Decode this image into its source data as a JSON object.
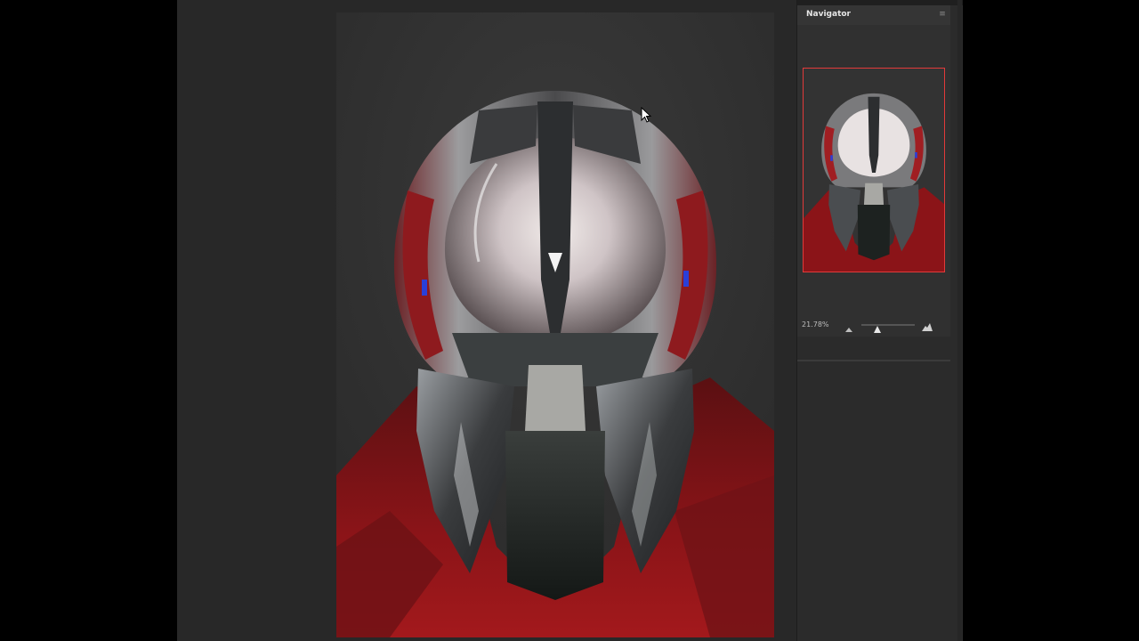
{
  "navigator": {
    "title": "Navigator",
    "menu_icon": "panel-menu-icon",
    "zoom_level": "21.78%",
    "zoom_slider_fraction": 0.3,
    "view_rect_color": "#e23a3a"
  },
  "icons": {
    "zoom_out": "mountain-small-icon",
    "zoom_in": "mountain-large-icon",
    "cursor": "arrow-cursor-icon"
  },
  "colors": {
    "workspace": "#282828",
    "panel": "#303030",
    "accent_red": "#b3161b"
  }
}
